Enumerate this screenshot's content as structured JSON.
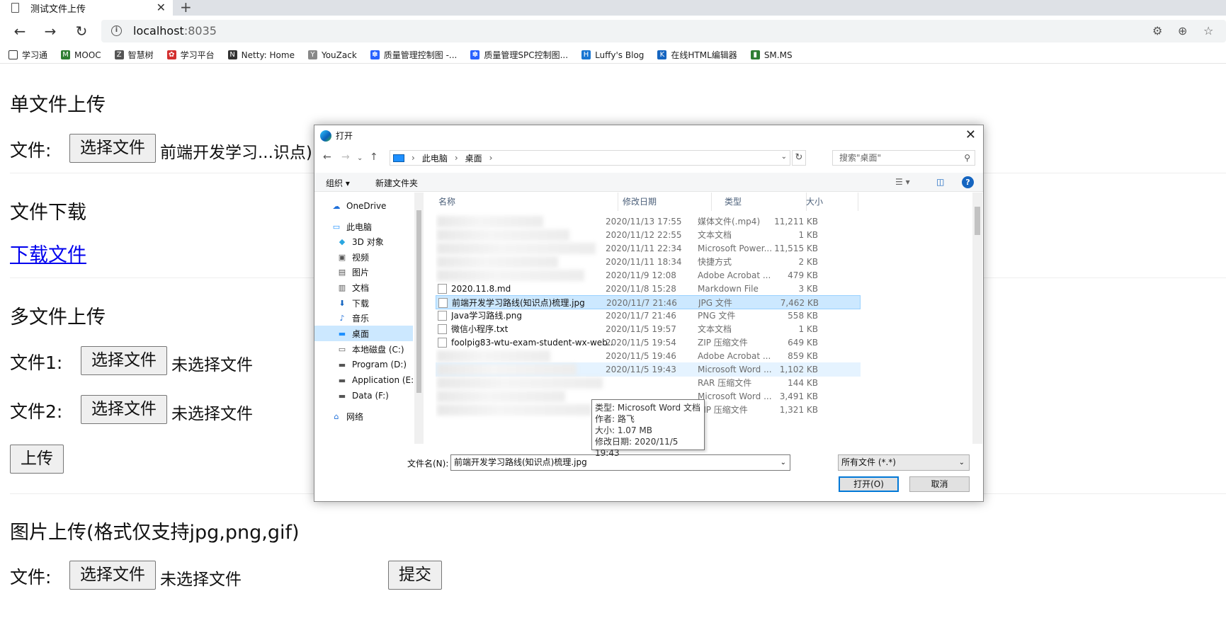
{
  "browser": {
    "tab_title": "测试文件上传",
    "tab_close": "✕",
    "new_tab": "+",
    "url_host": "localhost",
    "url_port": ":8035",
    "bookmarks": [
      {
        "label": "学习通",
        "icon": "bookmark-outline-icon",
        "color": "#333333"
      },
      {
        "label": "MOOC",
        "icon": "mooc-icon",
        "color": "#2e7d32"
      },
      {
        "label": "智慧树",
        "icon": "zhihuishu-icon",
        "color": "#555555"
      },
      {
        "label": "学习平台",
        "icon": "platform-icon",
        "color": "#d32f2f"
      },
      {
        "label": "Netty: Home",
        "icon": "netty-icon",
        "color": "#333333"
      },
      {
        "label": "YouZack",
        "icon": "youzack-icon",
        "color": "#888888"
      },
      {
        "label": "质量管理控制图 -...",
        "icon": "baidu-paw-icon",
        "color": "#2962ff"
      },
      {
        "label": "质量管理SPC控制图...",
        "icon": "baidu-paw-icon",
        "color": "#2962ff"
      },
      {
        "label": "Luffy's Blog",
        "icon": "luffy-h-icon",
        "color": "#1976d2"
      },
      {
        "label": "在线HTML编辑器",
        "icon": "k-editor-icon",
        "color": "#1565c0"
      },
      {
        "label": "SM.MS",
        "icon": "bars-icon",
        "color": "#2e7d32"
      }
    ]
  },
  "page": {
    "single_title": "单文件上传",
    "file_label": "文件:",
    "choose_file": "选择文件",
    "single_filename": "前端开发学习...识点)",
    "download_title": "文件下载",
    "download_link": "下载文件",
    "multi_title": "多文件上传",
    "file1_label": "文件1:",
    "file2_label": "文件2:",
    "no_file": "未选择文件",
    "upload_button": "上传",
    "image_title": "图片上传(格式仅支持jpg,png,gif)",
    "submit_button": "提交"
  },
  "dialog": {
    "title": "打开",
    "close": "✕",
    "breadcrumb": [
      "此电脑",
      "桌面"
    ],
    "search_placeholder": "搜索\"桌面\"",
    "organize": "组织 ▾",
    "new_folder": "新建文件夹",
    "help": "?",
    "nav_items": [
      {
        "label": "OneDrive",
        "icon": "onedrive-icon"
      },
      {
        "label": "此电脑",
        "icon": "computer-icon"
      },
      {
        "label": "3D 对象",
        "icon": "3d-objects-icon"
      },
      {
        "label": "视频",
        "icon": "video-folder-icon"
      },
      {
        "label": "图片",
        "icon": "pictures-folder-icon"
      },
      {
        "label": "文档",
        "icon": "documents-folder-icon"
      },
      {
        "label": "下载",
        "icon": "download-arrow-icon"
      },
      {
        "label": "音乐",
        "icon": "music-note-icon"
      },
      {
        "label": "桌面",
        "icon": "desktop-folder-icon"
      },
      {
        "label": "本地磁盘 (C:)",
        "icon": "drive-c-icon"
      },
      {
        "label": "Program (D:)",
        "icon": "drive-icon"
      },
      {
        "label": "Application (E:)",
        "icon": "drive-icon"
      },
      {
        "label": "Data (F:)",
        "icon": "drive-icon"
      },
      {
        "label": "网络",
        "icon": "network-icon"
      }
    ],
    "columns": {
      "name": "名称",
      "date": "修改日期",
      "type": "类型",
      "size": "大小"
    },
    "files": [
      {
        "name": "",
        "date": "2020/11/13 17:55",
        "type": "媒体文件(.mp4)",
        "size": "11,211 KB"
      },
      {
        "name": "",
        "date": "2020/11/12 22:55",
        "type": "文本文档",
        "size": "1 KB"
      },
      {
        "name": "",
        "date": "2020/11/11 22:34",
        "type": "Microsoft Power...",
        "size": "11,515 KB"
      },
      {
        "name": "",
        "date": "2020/11/11 18:34",
        "type": "快捷方式",
        "size": "2 KB"
      },
      {
        "name": "",
        "date": "2020/11/9 12:08",
        "type": "Adobe Acrobat ...",
        "size": "479 KB"
      },
      {
        "name": "2020.11.8.md",
        "date": "2020/11/8 15:28",
        "type": "Markdown File",
        "size": "3 KB"
      },
      {
        "name": "前端开发学习路线(知识点)梳理.jpg",
        "date": "2020/11/7 21:46",
        "type": "JPG 文件",
        "size": "7,462 KB"
      },
      {
        "name": "Java学习路线.png",
        "date": "2020/11/7 21:46",
        "type": "PNG 文件",
        "size": "558 KB"
      },
      {
        "name": "微信小程序.txt",
        "date": "2020/11/5 19:57",
        "type": "文本文档",
        "size": "1 KB"
      },
      {
        "name": "foolpig83-wtu-exam-student-wx-web...",
        "date": "2020/11/5 19:54",
        "type": "ZIP 压缩文件",
        "size": "649 KB"
      },
      {
        "name": "",
        "date": "2020/11/5 19:46",
        "type": "Adobe Acrobat ...",
        "size": "859 KB"
      },
      {
        "name": "",
        "date": "2020/11/5 19:43",
        "type": "Microsoft Word ...",
        "size": "1,102 KB"
      },
      {
        "name": "",
        "date": "",
        "type": "RAR 压缩文件",
        "size": "144 KB"
      },
      {
        "name": "",
        "date": "",
        "type": "Microsoft Word ...",
        "size": "3,491 KB"
      },
      {
        "name": "",
        "date": "",
        "type": "ZIP 压缩文件",
        "size": "1,321 KB"
      }
    ],
    "tooltip": {
      "type": "类型: Microsoft Word 文档",
      "author": "作者: 路飞",
      "size": "大小: 1.07 MB",
      "modified": "修改日期: 2020/11/5 19:43"
    },
    "filename_label": "文件名(N):",
    "filename_value": "前端开发学习路线(知识点)梳理.jpg",
    "filetype_value": "所有文件 (*.*)",
    "open_button": "打开(O)",
    "cancel_button": "取消"
  }
}
